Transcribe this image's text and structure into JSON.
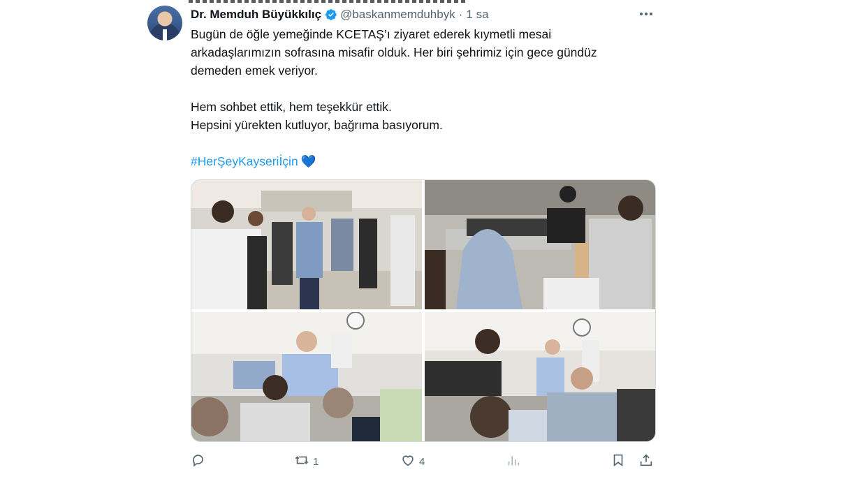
{
  "tweet": {
    "author_name": "Dr. Memduh Büyükkılıç",
    "handle": "@baskanmemduhbyk",
    "separator": "·",
    "time": "1 sa",
    "paragraph1": "Bugün de öğle yemeğinde KCETAŞ’ı ziyaret ederek kıymetli mesai\narkadaşlarımızın sofrasına misafir olduk. Her biri şehrimiz için gece gündüz\ndemeden emek veriyor.",
    "paragraph2": "Hem sohbet ettik, hem teşekkür ettik.\nHepsini yürekten kutluyor, bağrıma basıyorum.",
    "hashtag": "#HerŞeyKayseriİçin",
    "emoji": "💙"
  },
  "actions": {
    "reply_count": "",
    "retweet_count": "1",
    "like_count": "4",
    "views_count": ""
  },
  "colors": {
    "accent": "#1d9bf0",
    "muted": "#536471",
    "text": "#0f1419"
  },
  "icons": [
    "verified-badge-icon",
    "more-icon",
    "reply-icon",
    "retweet-icon",
    "like-icon",
    "views-icon",
    "bookmark-icon",
    "share-icon"
  ]
}
